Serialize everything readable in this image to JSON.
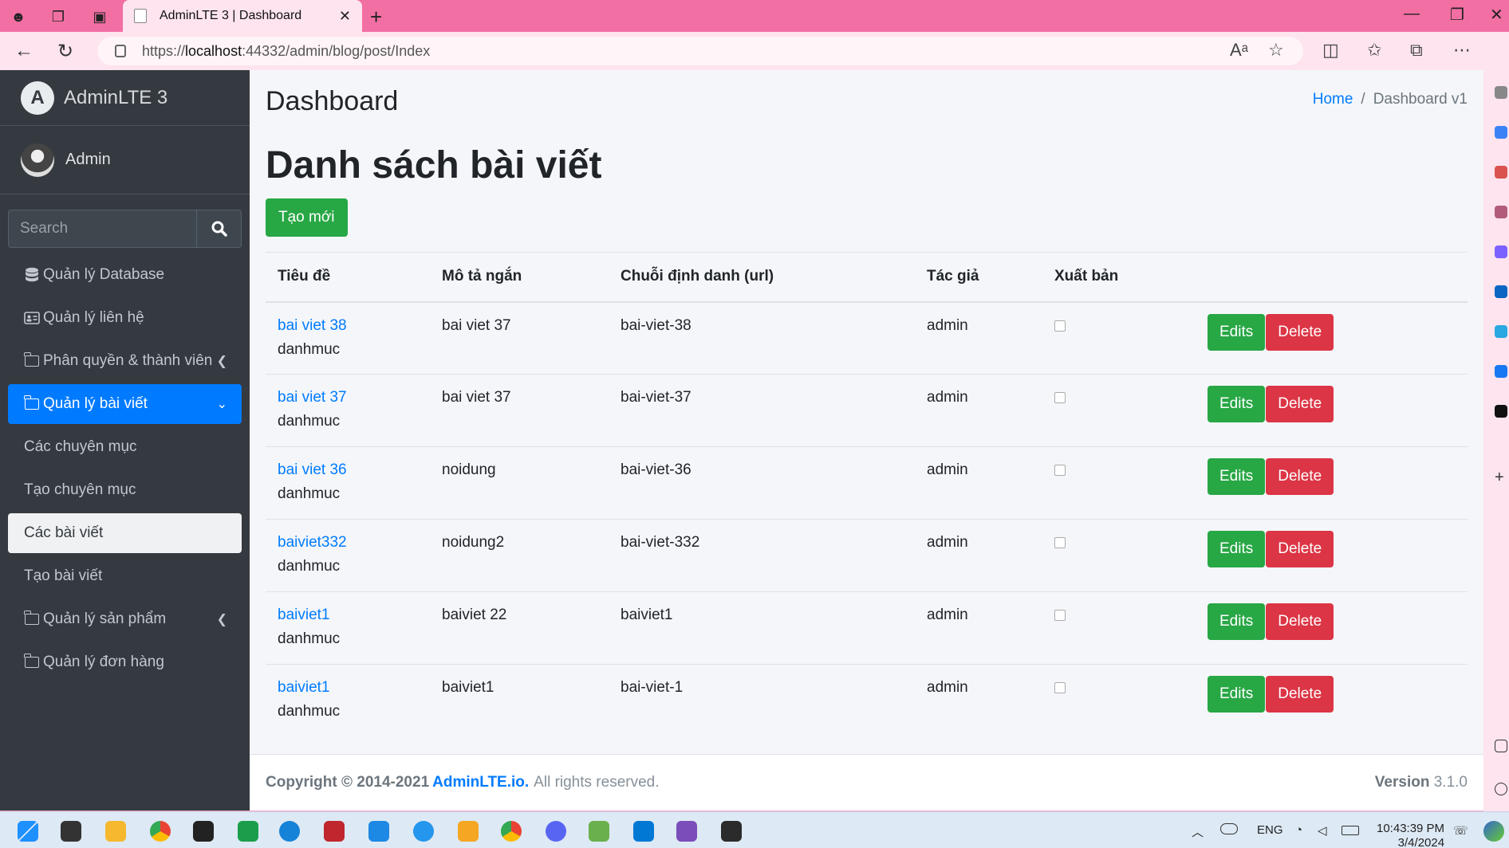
{
  "browser": {
    "tab_title": "AdminLTE 3 | Dashboard",
    "url_prefix": "https://",
    "url_host": "localhost",
    "url_rest": ":44332/admin/blog/post/Index"
  },
  "sidebar": {
    "brand": "AdminLTE 3",
    "brand_logo": "A",
    "user_name": "Admin",
    "search_placeholder": "Search",
    "items": [
      {
        "label": "Quản lý Database",
        "icon": "database-icon"
      },
      {
        "label": "Quản lý liên hệ",
        "icon": "id-card-icon"
      },
      {
        "label": "Phân quyền & thành viên",
        "icon": "folder-icon",
        "chevron": "‹"
      },
      {
        "label": "Quản lý bài viết",
        "icon": "folder-icon",
        "chevron": "⌄",
        "state": "active"
      },
      {
        "label": "Các chuyên mục"
      },
      {
        "label": "Tạo chuyên mục"
      },
      {
        "label": "Các bài viết",
        "state": "current"
      },
      {
        "label": "Tạo bài viết"
      },
      {
        "label": "Quản lý sản phẩm",
        "icon": "folder-icon",
        "chevron": "‹"
      },
      {
        "label": "Quản lý đơn hàng",
        "icon": "folder-icon"
      }
    ]
  },
  "header": {
    "title": "Dashboard",
    "breadcrumb_home": "Home",
    "breadcrumb_sep": "/",
    "breadcrumb_current": "Dashboard v1"
  },
  "main": {
    "heading": "Danh sách bài viết",
    "create_label": "Tạo mới",
    "columns": [
      "Tiêu đề",
      "Mô tả ngắn",
      "Chuỗi định danh (url)",
      "Tác giả",
      "Xuất bản"
    ],
    "edit_label": "Edits",
    "delete_label": "Delete",
    "rows": [
      {
        "title": "bai viet 38",
        "category": "danhmuc",
        "desc": "bai viet 37",
        "slug": "bai-viet-38",
        "author": "admin",
        "published": false
      },
      {
        "title": "bai viet 37",
        "category": "danhmuc",
        "desc": "bai viet 37",
        "slug": "bai-viet-37",
        "author": "admin",
        "published": false
      },
      {
        "title": "bai viet 36",
        "category": "danhmuc",
        "desc": "noidung",
        "slug": "bai-viet-36",
        "author": "admin",
        "published": false
      },
      {
        "title": "baiviet332",
        "category": "danhmuc",
        "desc": "noidung2",
        "slug": "bai-viet-332",
        "author": "admin",
        "published": false
      },
      {
        "title": "baiviet1",
        "category": "danhmuc",
        "desc": "baiviet 22",
        "slug": "baiviet1",
        "author": "admin",
        "published": false
      },
      {
        "title": "baiviet1",
        "category": "danhmuc",
        "desc": "baiviet1",
        "slug": "bai-viet-1",
        "author": "admin",
        "published": false
      }
    ]
  },
  "footer": {
    "copyright": "Copyright © 2014-2021",
    "link": "AdminLTE.io.",
    "rights": "All rights reserved.",
    "version_label": "Version",
    "version": "3.1.0"
  },
  "taskbar": {
    "lang": "ENG",
    "time": "10:43:39 PM",
    "date": "3/4/2024"
  }
}
